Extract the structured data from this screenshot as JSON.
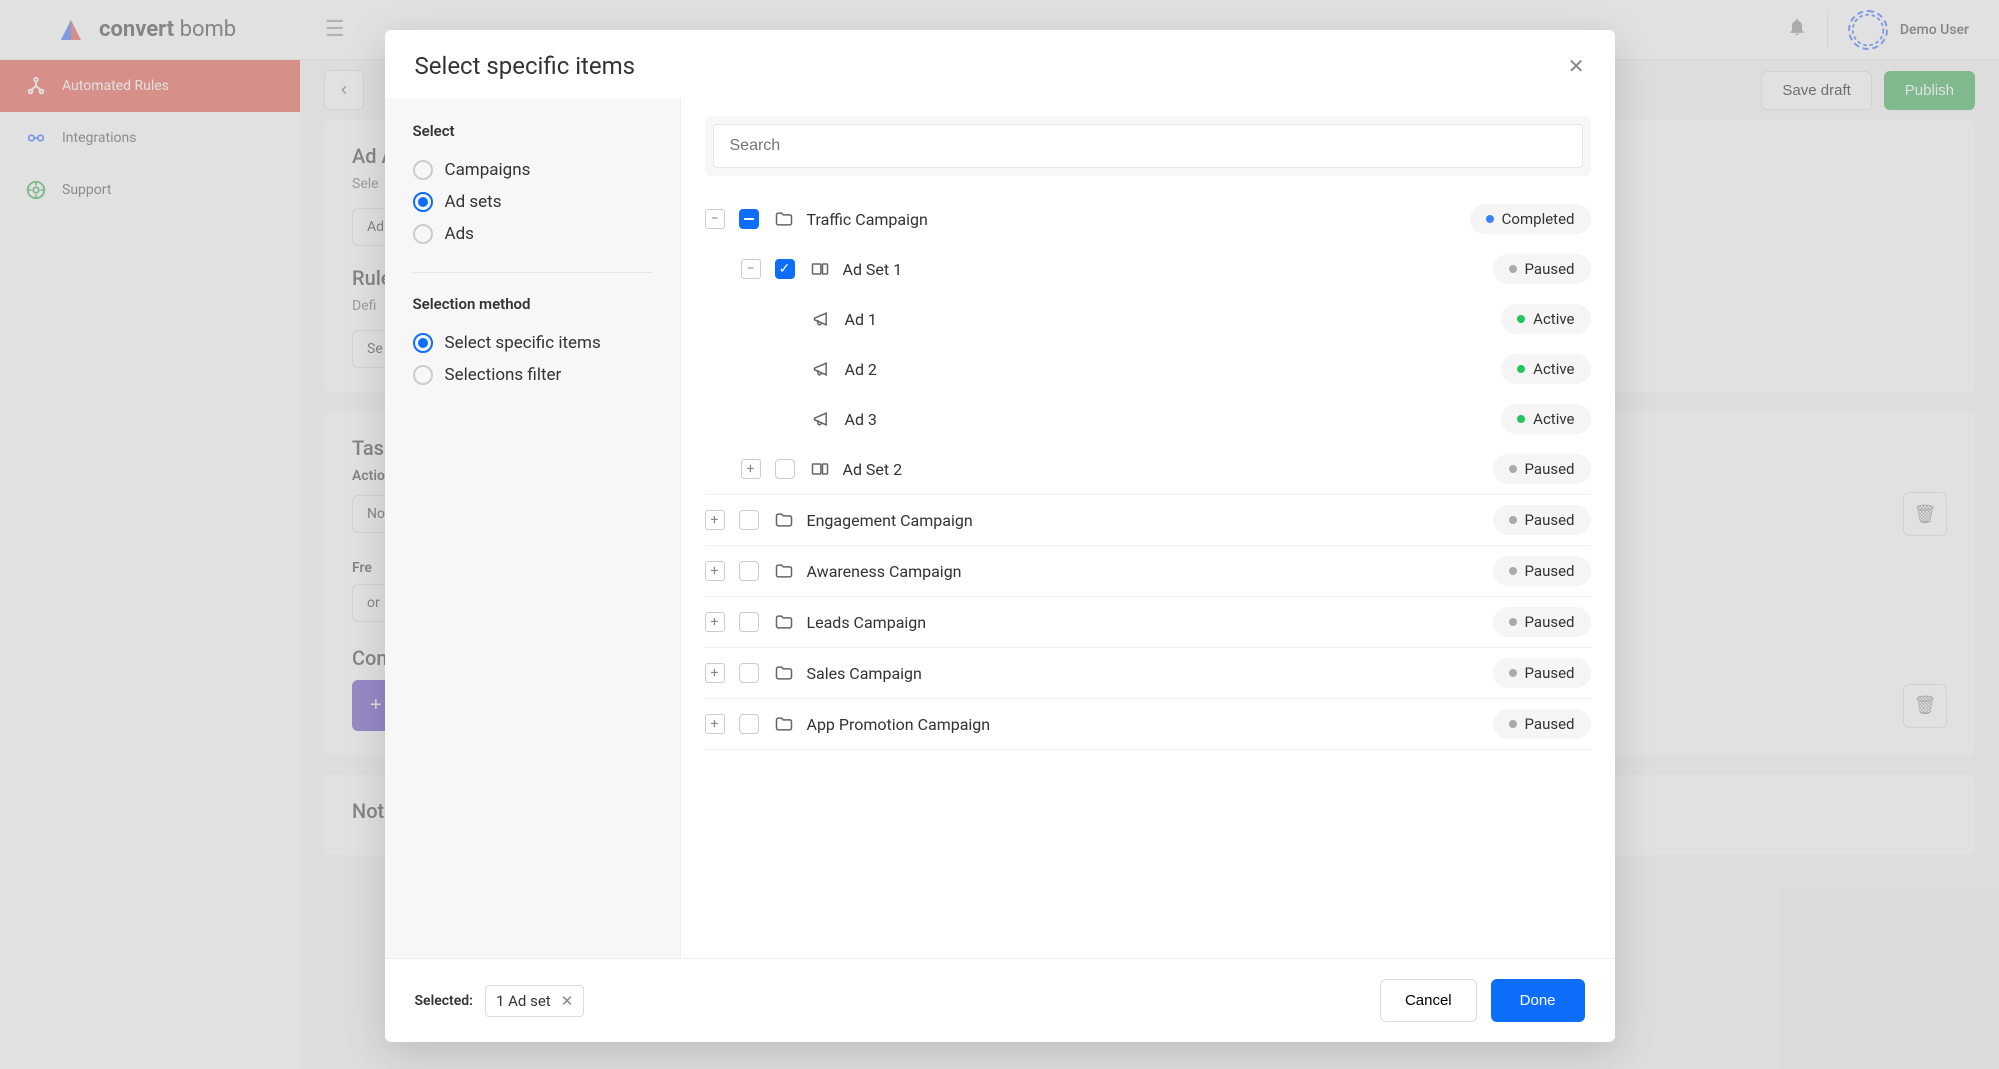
{
  "brand": {
    "name1": "convert",
    "name2": " bomb"
  },
  "user": {
    "name": "Demo User"
  },
  "nav": {
    "items": [
      {
        "label": "Automated Rules"
      },
      {
        "label": "Integrations"
      },
      {
        "label": "Support"
      }
    ]
  },
  "topbar": {
    "save": "Save draft",
    "publish": "Publish"
  },
  "bg_panels": {
    "ad_account_title": "Ad A",
    "ad_account_sub": "Sele",
    "ad_account_select": "Ad A",
    "rule_title": "Rule",
    "rule_sub": "Defi",
    "rule_select": "Se",
    "task_title": "Task",
    "action_label": "Actio",
    "not_select": "Not",
    "freq_label": "Fre",
    "freq_select": "or",
    "con_title": "Con",
    "plus": "+",
    "notif_title": "Notifications"
  },
  "modal": {
    "title": "Select specific items",
    "left": {
      "select_label": "Select",
      "opt_campaigns": "Campaigns",
      "opt_adsets": "Ad sets",
      "opt_ads": "Ads",
      "method_label": "Selection method",
      "opt_specific": "Select specific items",
      "opt_filter": "Selections filter"
    },
    "search_placeholder": "Search",
    "tree": {
      "c1": "Traffic Campaign",
      "c1_status": "Completed",
      "as1": "Ad Set 1",
      "as1_status": "Paused",
      "ad1": "Ad 1",
      "ad1_status": "Active",
      "ad2": "Ad 2",
      "ad2_status": "Active",
      "ad3": "Ad 3",
      "ad3_status": "Active",
      "as2": "Ad Set 2",
      "as2_status": "Paused",
      "c2": "Engagement Campaign",
      "c2_status": "Paused",
      "c3": "Awareness Campaign",
      "c3_status": "Paused",
      "c4": "Leads Campaign",
      "c4_status": "Paused",
      "c5": "Sales Campaign",
      "c5_status": "Paused",
      "c6": "App Promotion Campaign",
      "c6_status": "Paused"
    },
    "footer": {
      "selected_label": "Selected:",
      "chip": "1 Ad set",
      "cancel": "Cancel",
      "done": "Done"
    }
  }
}
